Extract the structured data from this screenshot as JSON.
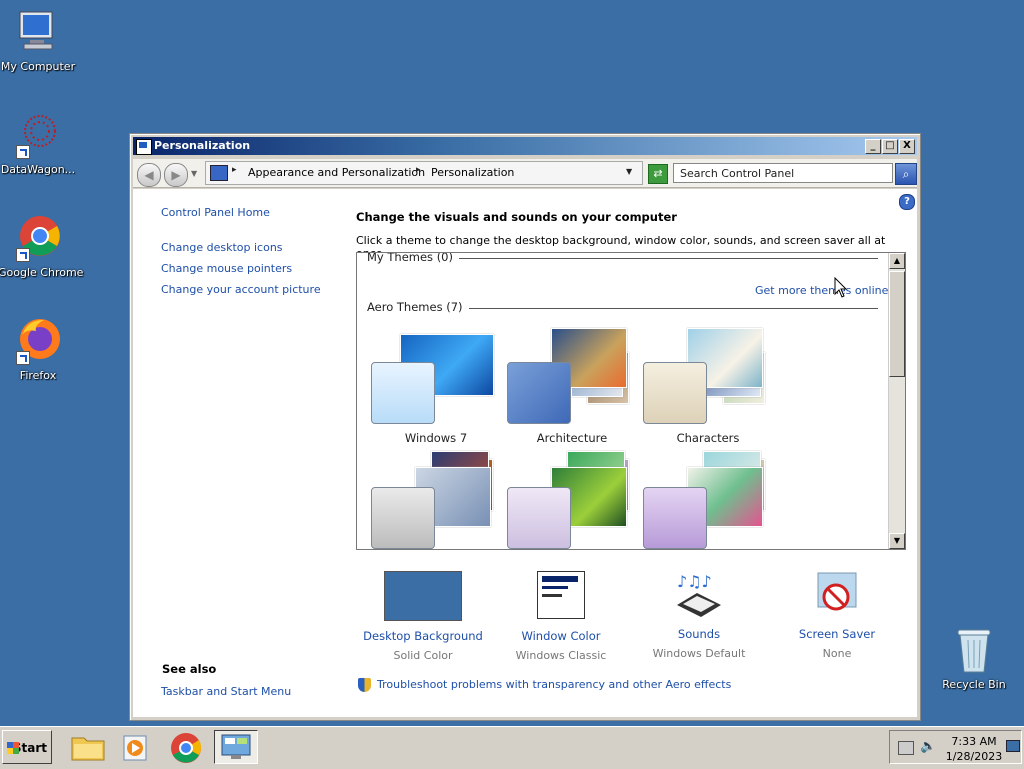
{
  "desktop": {
    "icons": [
      {
        "label": "My Computer",
        "icon": "computer-icon"
      },
      {
        "label": "DataWagon...",
        "icon": "datawagon-icon"
      },
      {
        "label": "Google Chrome",
        "icon": "chrome-icon"
      },
      {
        "label": "Firefox",
        "icon": "firefox-icon"
      },
      {
        "label": "Recycle Bin",
        "icon": "recycle-bin-icon"
      }
    ]
  },
  "window": {
    "title": "Personalization",
    "controls": {
      "minimize": "_",
      "maximize": "□",
      "close": "X"
    },
    "breadcrumb": [
      "Appearance and Personalization",
      "Personalization"
    ],
    "search_placeholder": "Search Control Panel",
    "help": "?"
  },
  "nav": {
    "home": "Control Panel Home",
    "links": [
      "Change desktop icons",
      "Change mouse pointers",
      "Change your account picture"
    ],
    "see_also_title": "See also",
    "see_also": [
      "Taskbar and Start Menu"
    ]
  },
  "main": {
    "heading": "Change the visuals and sounds on your computer",
    "subheading": "Click a theme to change the desktop background, window color, sounds, and screen saver all at once.",
    "my_themes": "My Themes (0)",
    "get_more": "Get more themes online",
    "aero_themes": "Aero Themes (7)",
    "themes": [
      "Windows 7",
      "Architecture",
      "Characters",
      "",
      "",
      ""
    ]
  },
  "bottom": [
    {
      "label": "Desktop Background",
      "sub": "Solid Color"
    },
    {
      "label": "Window Color",
      "sub": "Windows Classic"
    },
    {
      "label": "Sounds",
      "sub": "Windows Default"
    },
    {
      "label": "Screen Saver",
      "sub": "None"
    }
  ],
  "troubleshoot": "Troubleshoot problems with transparency and other Aero effects",
  "taskbar": {
    "start": "Start",
    "time": "7:33 AM",
    "date": "1/28/2023"
  },
  "colors": {
    "desktop": "#3a6ea5",
    "link": "#1e4fa8",
    "accent": "#0a246a"
  }
}
